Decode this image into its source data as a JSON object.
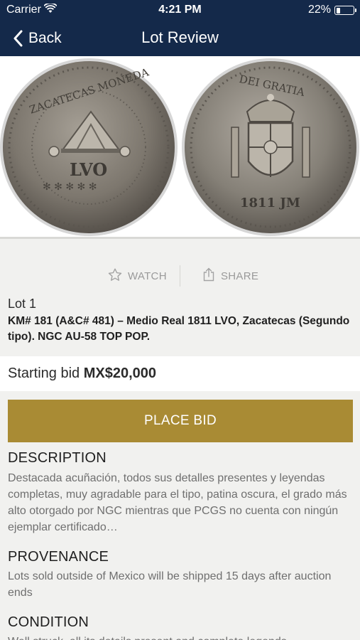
{
  "status_bar": {
    "carrier": "Carrier",
    "time": "4:21 PM",
    "battery": "22%"
  },
  "nav": {
    "back_label": "Back",
    "title": "Lot Review"
  },
  "actions": {
    "watch_label": "WATCH",
    "share_label": "SHARE"
  },
  "lot": {
    "number": "Lot 1",
    "title": "KM# 181 (A&C# 481) – Medio Real 1811 LVO, Zacatecas (Segundo tipo). NGC AU-58 TOP POP."
  },
  "bid": {
    "label": "Starting bid",
    "amount": "MX$20,000",
    "button_label": "PLACE BID"
  },
  "description": {
    "heading": "DESCRIPTION",
    "text": "Destacada acuñación, todos sus detalles presentes y leyendas completas, muy agradable para el tipo, patina oscura, el grado más alto otorgado por NGC mientras que PCGS no cuenta con ningún ejemplar certificado…"
  },
  "provenance": {
    "heading": "PROVENANCE",
    "text": "Lots sold outside of Mexico will be shipped 15 days after auction ends"
  },
  "condition": {
    "heading": "CONDITION",
    "text": "Well struck, all its details present and complete legends."
  },
  "colors": {
    "nav_bg": "#14294a",
    "accent_gold": "#a98b34",
    "page_bg": "#f1f1ef",
    "muted_text": "#6f6f6f"
  }
}
